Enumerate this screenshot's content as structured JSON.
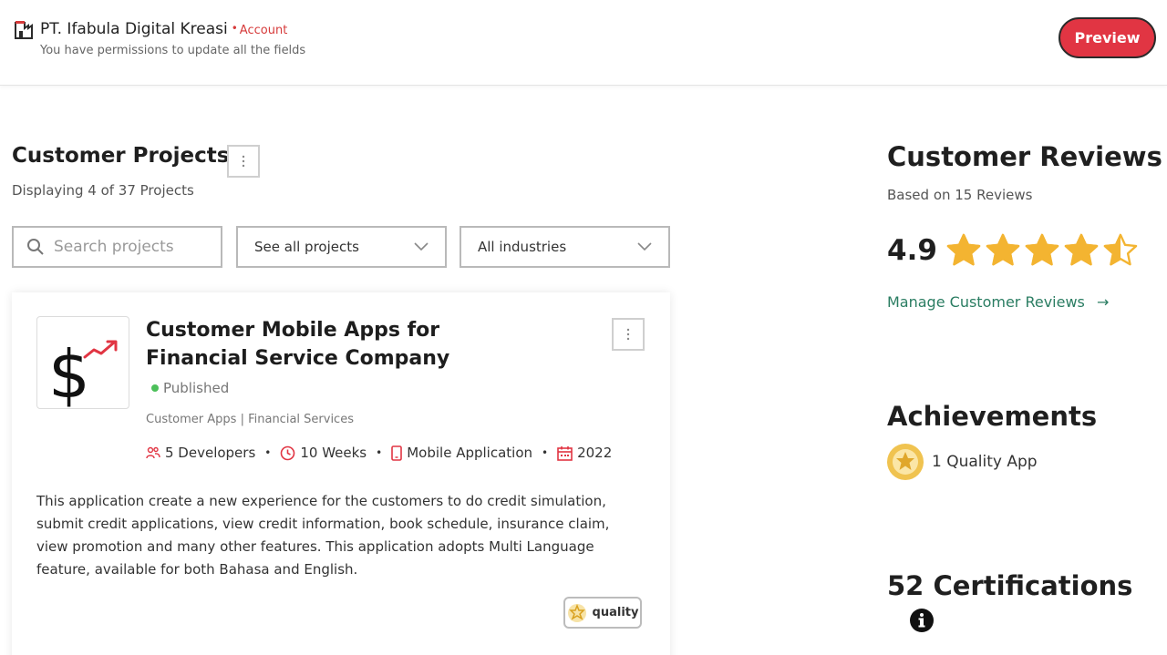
{
  "header": {
    "company_name": "PT. Ifabula Digital Kreasi",
    "separator": "•",
    "account_label": "Account",
    "permissions_text": "You have permissions to update all the fields",
    "preview_label": "Preview"
  },
  "projects": {
    "title": "Customer Projects",
    "subtitle": "Displaying 4 of 37 Projects",
    "search_placeholder": "Search projects",
    "filter_projects": "See all projects",
    "filter_industries": "All industries"
  },
  "card": {
    "title": "Customer Mobile Apps for Financial Service Company",
    "status": "Published",
    "categories": "Customer Apps | Financial Services",
    "meta": {
      "developers": "5 Developers",
      "duration": "10 Weeks",
      "platform": "Mobile Application",
      "year": "2022",
      "bullet": "•"
    },
    "description": "This application create a new experience for the customers to do credit simulation, submit credit applications, view credit information, book schedule, insurance claim, view promotion and many other features. This application adopts Multi Language feature, available for both Bahasa and English.",
    "badge_label": "quality"
  },
  "reviews": {
    "title": "Customer Reviews",
    "subtitle": "Based on 15 Reviews",
    "rating": "4.9",
    "rating_value": 4.9,
    "stars_max": 5,
    "manage_label": "Manage Customer Reviews",
    "manage_arrow": "→"
  },
  "achievements": {
    "title": "Achievements",
    "item": "1 Quality App"
  },
  "certifications": {
    "title": "52 Certifications"
  },
  "colors": {
    "accent_red": "#e13543",
    "link_green": "#2a7d62",
    "star_gold": "#f3b431",
    "published_green": "#4cc05a"
  }
}
